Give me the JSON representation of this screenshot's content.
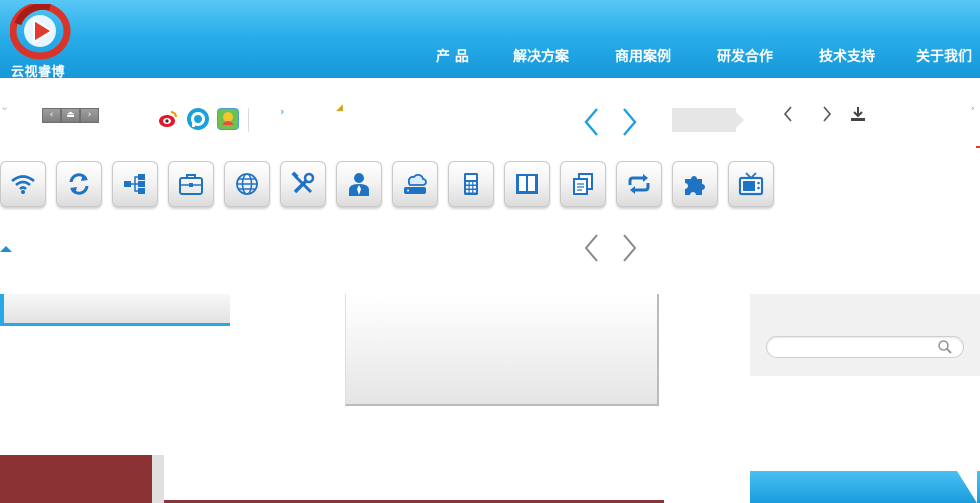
{
  "brand": {
    "name": "云视睿博",
    "logo_colors": {
      "ring": "#e23a2e",
      "ring_dark": "#b01f19",
      "play": "#e23a2e",
      "play_stroke": "#ffffff"
    }
  },
  "nav": [
    {
      "label": "产  品"
    },
    {
      "label": "解决方案"
    },
    {
      "label": "商用案例"
    },
    {
      "label": "研发合作"
    },
    {
      "label": "技术支持"
    },
    {
      "label": "关于我们"
    }
  ],
  "toolbar": {
    "mini_buttons": [
      "‹",
      "⏏",
      "›"
    ],
    "share_icons": [
      "weibo-icon",
      "tencent-icon",
      "renren-icon"
    ]
  },
  "icons": [
    {
      "name": "wifi-icon"
    },
    {
      "name": "refresh-icon"
    },
    {
      "name": "network-icon"
    },
    {
      "name": "briefcase-icon"
    },
    {
      "name": "globe-icon"
    },
    {
      "name": "tools-icon"
    },
    {
      "name": "user-icon"
    },
    {
      "name": "cloud-storage-icon"
    },
    {
      "name": "calculator-icon"
    },
    {
      "name": "book-icon"
    },
    {
      "name": "copy-icon"
    },
    {
      "name": "repeat-icon"
    },
    {
      "name": "puzzle-icon"
    },
    {
      "name": "tv-icon"
    }
  ],
  "search": {
    "placeholder": "",
    "value": ""
  },
  "colors": {
    "header_top": "#58c6f5",
    "header_bottom": "#1597d9",
    "icon_blue": "#1f73c4",
    "accent_red": "#8a3234"
  }
}
